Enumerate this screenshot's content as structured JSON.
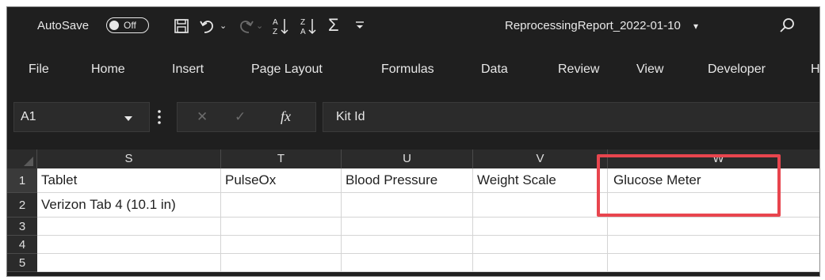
{
  "titlebar": {
    "autosave_label": "AutoSave",
    "autosave_state": "Off",
    "filename": "ReprocessingReport_2022-01-10",
    "filename_caret": "▾",
    "icons": [
      "save-icon",
      "undo-icon",
      "redo-icon",
      "sort-ascending-icon",
      "sort-descending-icon",
      "autosum-icon",
      "customize-qat-icon",
      "search-icon"
    ]
  },
  "ribbon": {
    "tabs": [
      "File",
      "Home",
      "Insert",
      "Page Layout",
      "Formulas",
      "Data",
      "Review",
      "View",
      "Developer",
      "H"
    ]
  },
  "formula_bar": {
    "name_box": "A1",
    "cancel_glyph": "✕",
    "enter_glyph": "✓",
    "fx_glyph": "fx",
    "content": "Kit Id"
  },
  "grid": {
    "columns": [
      "S",
      "T",
      "U",
      "V",
      "W"
    ],
    "rows": [
      "1",
      "2",
      "3",
      "4",
      "5"
    ],
    "cells": {
      "r1": [
        "Tablet",
        "PulseOx",
        "Blood Pressure",
        "Weight Scale",
        "Glucose Meter"
      ],
      "r2": [
        "Verizon Tab 4 (10.1 in)",
        "",
        "",
        "",
        ""
      ]
    }
  },
  "colors": {
    "chrome_bg": "#1f1f1f",
    "header_bg": "#2b2b2b",
    "highlight_box": "#e8454e"
  }
}
